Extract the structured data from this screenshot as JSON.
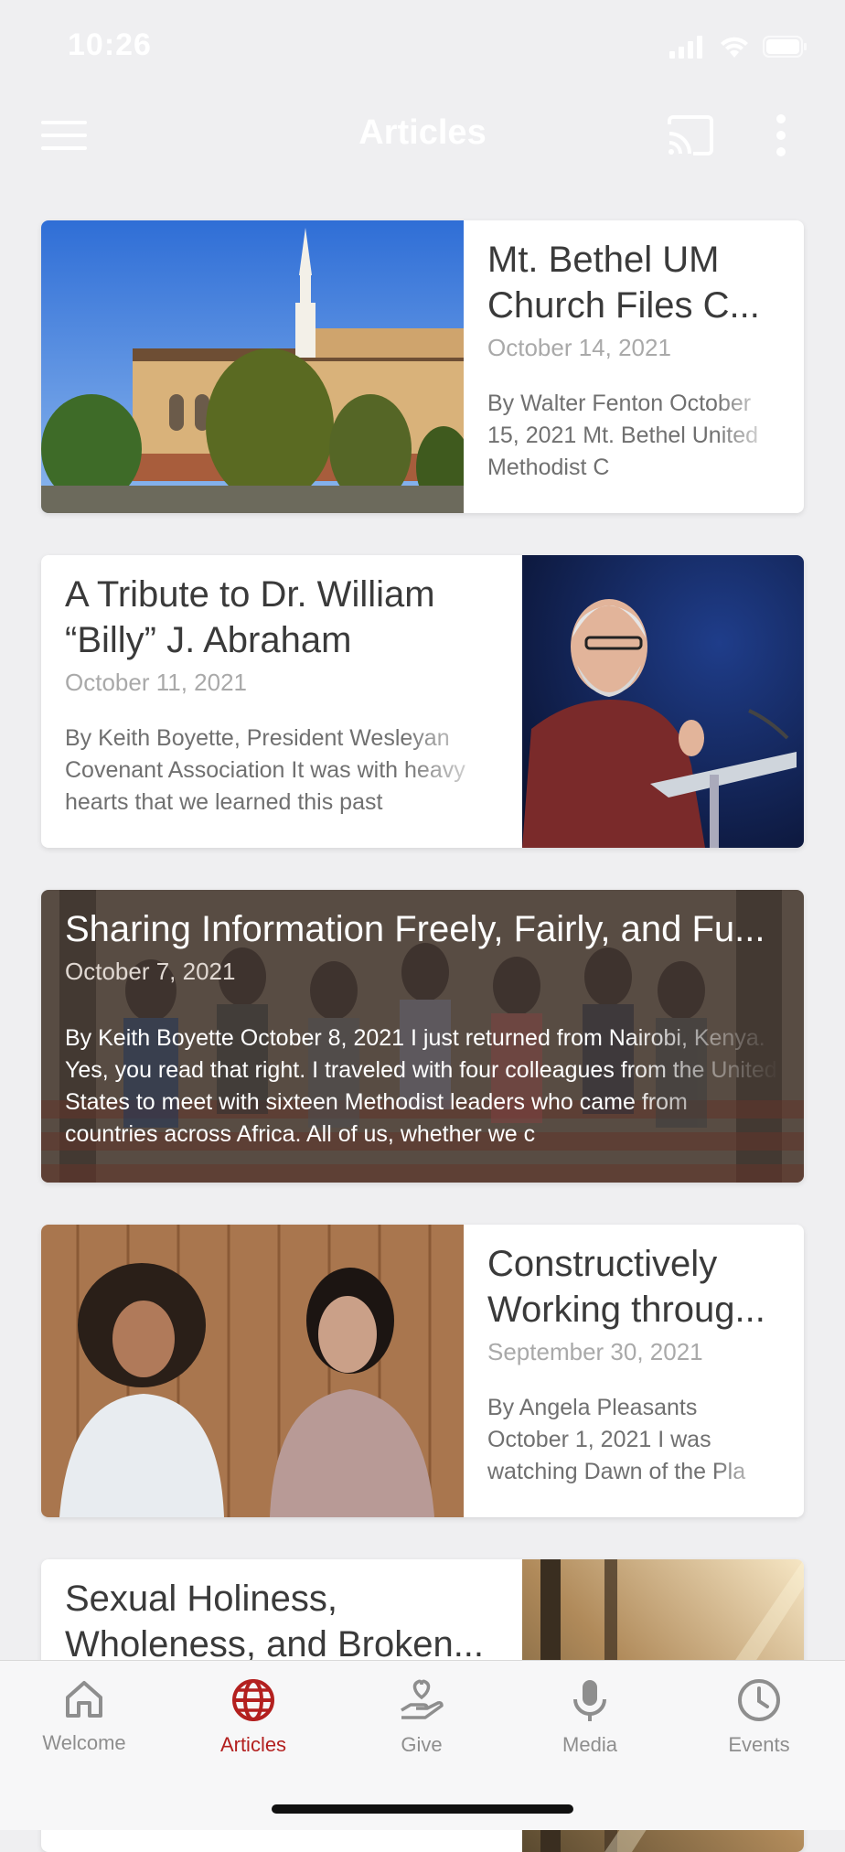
{
  "status_bar": {
    "time": "10:26"
  },
  "nav": {
    "title": "Articles",
    "left_icon": "menu-icon",
    "right_icons": [
      "cast-icon",
      "more-vertical-icon"
    ]
  },
  "articles": [
    {
      "title": "Mt. Bethel UM Church Files C...",
      "date": "October 14, 2021",
      "excerpt": "By Walter Fenton October 15, 2021 Mt. Bethel United Methodist C",
      "image": "church-steeple-photo",
      "layout": "image-left"
    },
    {
      "title": "A Tribute to Dr. William “Billy” J. Abraham",
      "date": "October 11, 2021",
      "excerpt": "By Keith Boyette, President Wesleyan Covenant Association It was with heavy hearts that we learned this past",
      "image": "speaker-at-podium-photo",
      "layout": "image-right"
    },
    {
      "title": "Sharing Information Freely, Fairly, and Fu...",
      "date": "October 7, 2021",
      "excerpt": "By Keith Boyette October 8, 2021 I just returned from Nairobi, Kenya. Yes, you read that right. I traveled with four colleagues from the United States to meet with sixteen Methodist leaders who came from countries across Africa. All of us, whether we c",
      "image": "group-photo-background",
      "layout": "overlay"
    },
    {
      "title": "Constructively Working throug...",
      "date": "September 30, 2021",
      "excerpt": "By Angela Pleasants October 1, 2021 I was watching Dawn of the Pla",
      "image": "two-women-photo",
      "layout": "image-left"
    },
    {
      "title": "Sexual Holiness, Wholeness, and Broken...",
      "date": "",
      "excerpt": "",
      "image": "forest-sunlight-photo",
      "layout": "image-right"
    }
  ],
  "tabs": [
    {
      "label": "Welcome",
      "icon": "home-icon",
      "active": false
    },
    {
      "label": "Articles",
      "icon": "globe-icon",
      "active": true
    },
    {
      "label": "Give",
      "icon": "give-heart-hand-icon",
      "active": false
    },
    {
      "label": "Media",
      "icon": "microphone-icon",
      "active": false
    },
    {
      "label": "Events",
      "icon": "clock-icon",
      "active": false
    }
  ],
  "colors": {
    "accent": "#b3201f",
    "background": "#efeff1",
    "tab_inactive": "#8e8e8e"
  }
}
